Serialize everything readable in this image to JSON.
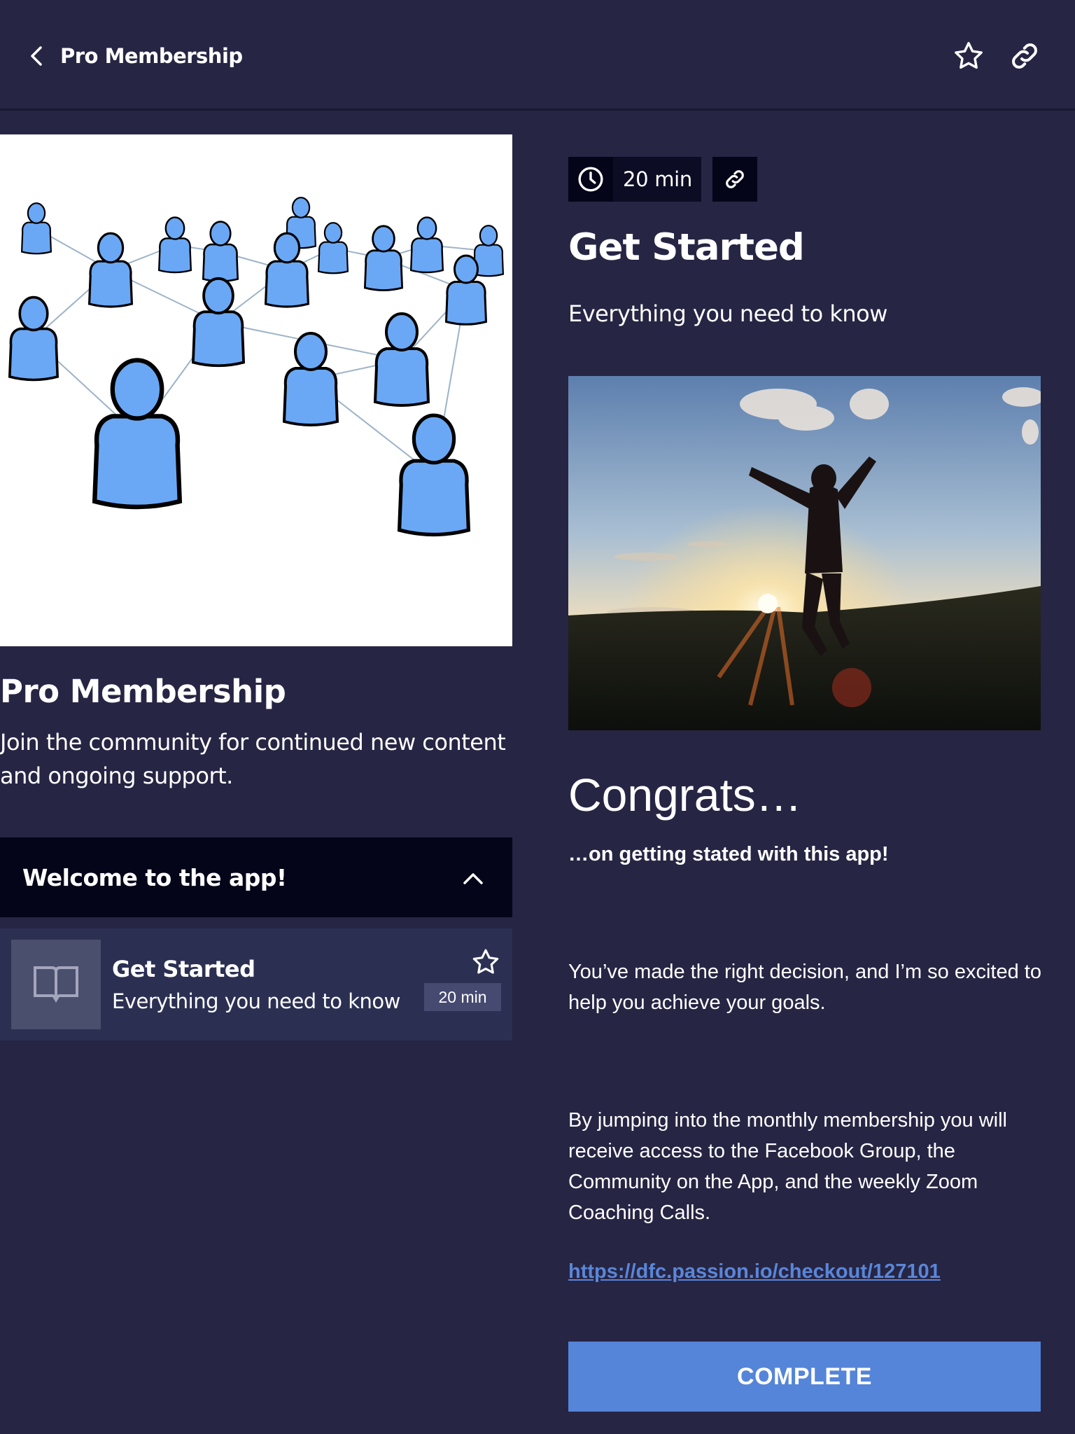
{
  "header": {
    "title": "Pro Membership",
    "back_icon": "chevron-left-icon",
    "favorite_icon": "star-outline-icon",
    "share_icon": "link-icon"
  },
  "course": {
    "hero_image_alt": "Network of connected people illustration",
    "title": "Pro Membership",
    "description": "Join the community for continued new content and ongoing support."
  },
  "section": {
    "title": "Welcome to the app!",
    "expanded": true,
    "lessons": [
      {
        "title": "Get Started",
        "subtitle": "Everything you need to know",
        "duration": "20 min",
        "thumbnail_icon": "book-icon",
        "favorite_icon": "star-outline-icon"
      }
    ]
  },
  "lesson": {
    "duration": "20 min",
    "title": "Get Started",
    "subtitle": "Everything you need to know",
    "image_alt": "Person jumping in front of a sunset",
    "heading": "Congrats…",
    "subheading": "…on getting stated with this app!",
    "paragraphs": [
      "You’ve made the right decision, and I’m so excited to help you achieve your goals.",
      "By jumping into the monthly membership you will receive access to the Facebook Group, the Community on the App, and the weekly Zoom Coaching Calls."
    ],
    "link_text": "https://dfc.passion.io/checkout/127101",
    "complete_label": "COMPLETE"
  },
  "colors": {
    "background": "#262544",
    "accordion": "#05051a",
    "lesson_row": "#2b3053",
    "accent": "#5585d9",
    "link": "#5a86d8"
  }
}
